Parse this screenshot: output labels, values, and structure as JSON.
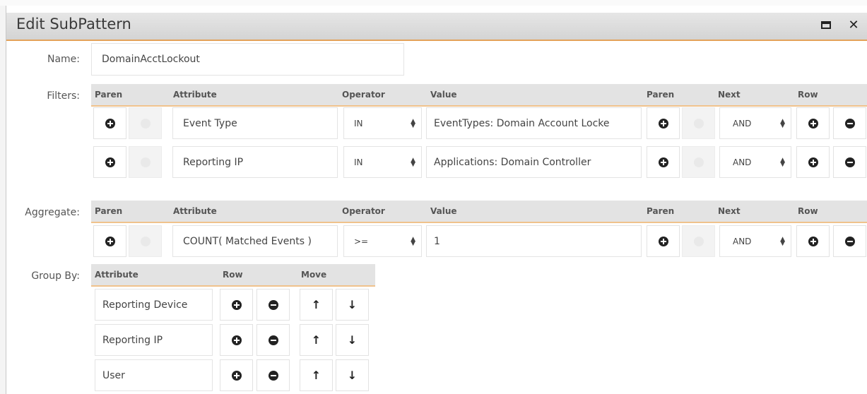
{
  "dialog": {
    "title": "Edit SubPattern"
  },
  "name": {
    "label": "Name:",
    "value": "DomainAcctLockout"
  },
  "filters": {
    "label": "Filters:",
    "headers": {
      "paren": "Paren",
      "attribute": "Attribute",
      "operator": "Operator",
      "value": "Value",
      "paren2": "Paren",
      "next": "Next",
      "row": "Row"
    },
    "rows": [
      {
        "attribute": "Event Type",
        "operator": "IN",
        "value": "EventTypes: Domain Account Locke",
        "next": "AND"
      },
      {
        "attribute": "Reporting IP",
        "operator": "IN",
        "value": "Applications: Domain Controller",
        "next": "AND"
      }
    ]
  },
  "aggregate": {
    "label": "Aggregate:",
    "headers": {
      "paren": "Paren",
      "attribute": "Attribute",
      "operator": "Operator",
      "value": "Value",
      "paren2": "Paren",
      "next": "Next",
      "row": "Row"
    },
    "rows": [
      {
        "attribute": "COUNT( Matched Events )",
        "operator": ">=",
        "value": "1",
        "next": "AND"
      }
    ]
  },
  "group_by": {
    "label": "Group By:",
    "headers": {
      "attribute": "Attribute",
      "row": "Row",
      "move": "Move"
    },
    "rows": [
      {
        "attribute": "Reporting Device"
      },
      {
        "attribute": "Reporting IP"
      },
      {
        "attribute": "User"
      }
    ]
  },
  "icons": {
    "maximize": "maximize-icon",
    "close": "close-icon",
    "add": "plus-circle-icon",
    "remove": "minus-circle-icon",
    "up": "arrow-up-icon",
    "down": "arrow-down-icon"
  },
  "colors": {
    "accent": "#e3a25a",
    "header_bg": "#e3e3e3"
  }
}
